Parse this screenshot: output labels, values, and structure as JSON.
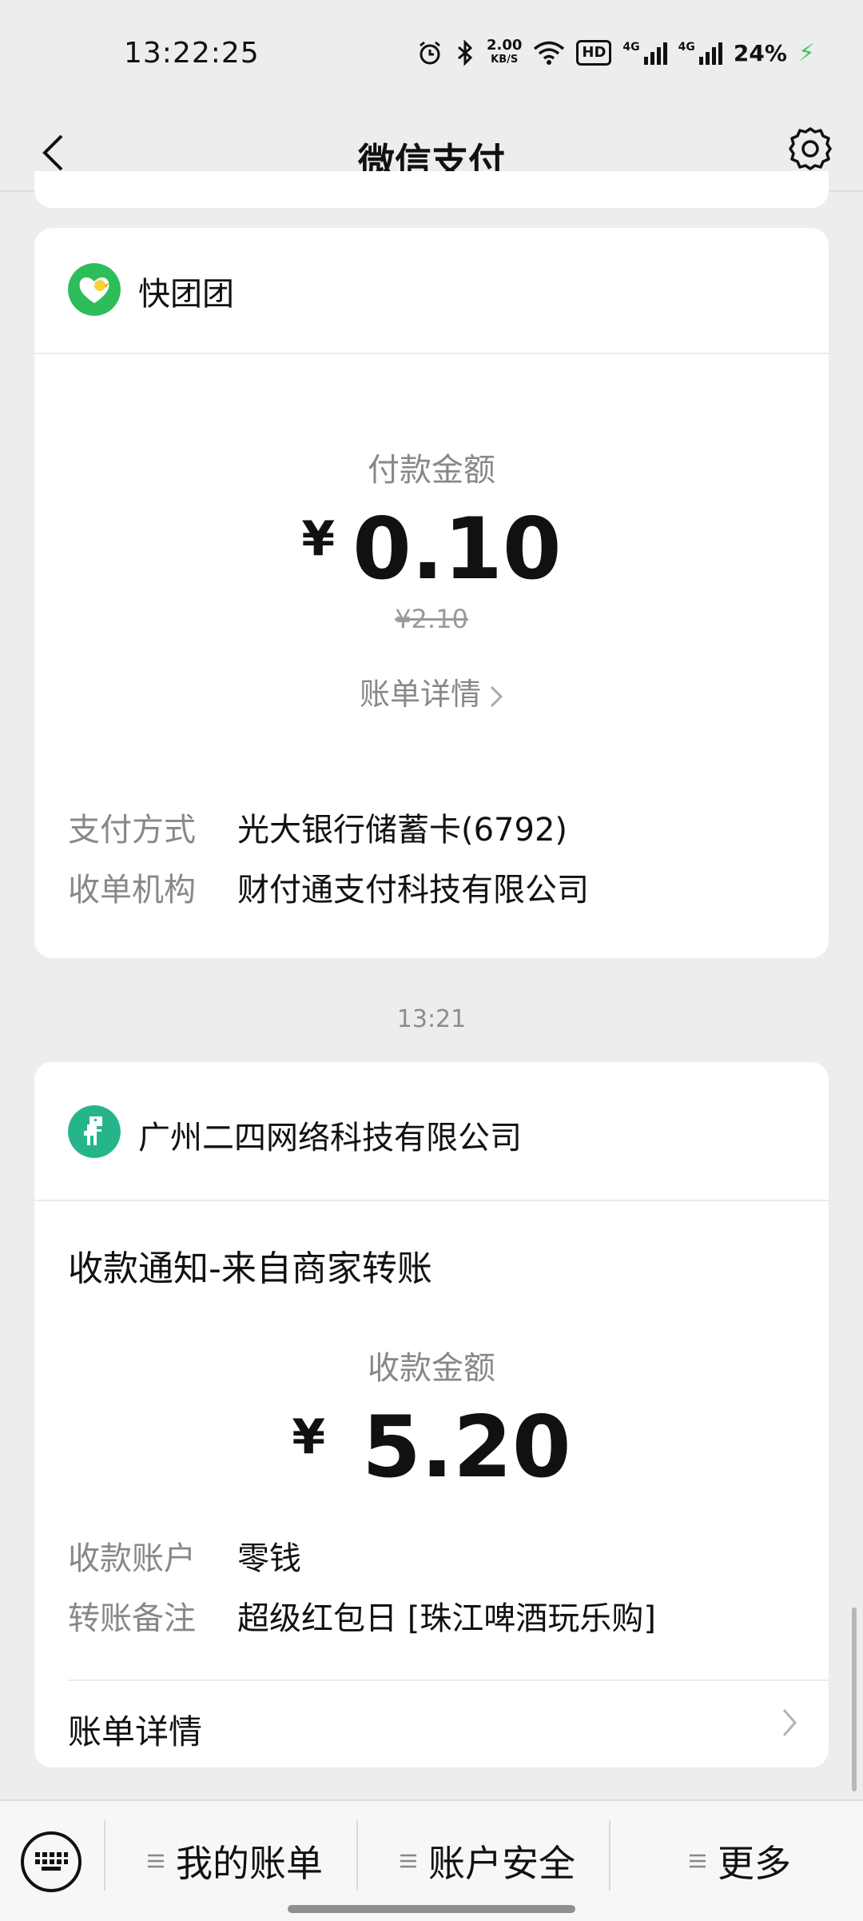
{
  "status": {
    "time": "13:22:25",
    "netspeed_value": "2.00",
    "netspeed_unit": "KB/S",
    "hd_label": "HD",
    "signal1_label": "4G",
    "signal2_label": "4G",
    "battery": "24%"
  },
  "nav": {
    "title": "微信支付"
  },
  "payment_card": {
    "merchant": "快团团",
    "amount_label": "付款金额",
    "currency": "¥",
    "amount": "0.10",
    "original_amount": "¥2.10",
    "detail_link": "账单详情",
    "rows": [
      {
        "key": "支付方式",
        "value": "光大银行储蓄卡(6792)"
      },
      {
        "key": "收单机构",
        "value": "财付通支付科技有限公司"
      }
    ]
  },
  "time_divider": "13:21",
  "receipt_card": {
    "merchant": "广州二四网络科技有限公司",
    "title": "收款通知-来自商家转账",
    "amount_label": "收款金额",
    "currency": "¥",
    "amount": "5.20",
    "rows": [
      {
        "key": "收款账户",
        "value": "零钱"
      },
      {
        "key": "转账备注",
        "value": "超级红包日 [珠江啤酒玩乐购]"
      }
    ],
    "detail_link": "账单详情"
  },
  "bottom_menu": {
    "items": [
      "我的账单",
      "账户安全",
      "更多"
    ]
  },
  "colors": {
    "brand_green": "#07c160",
    "kuaituantuan_green": "#2dbd5a",
    "merchant_teal": "#26b58a"
  }
}
